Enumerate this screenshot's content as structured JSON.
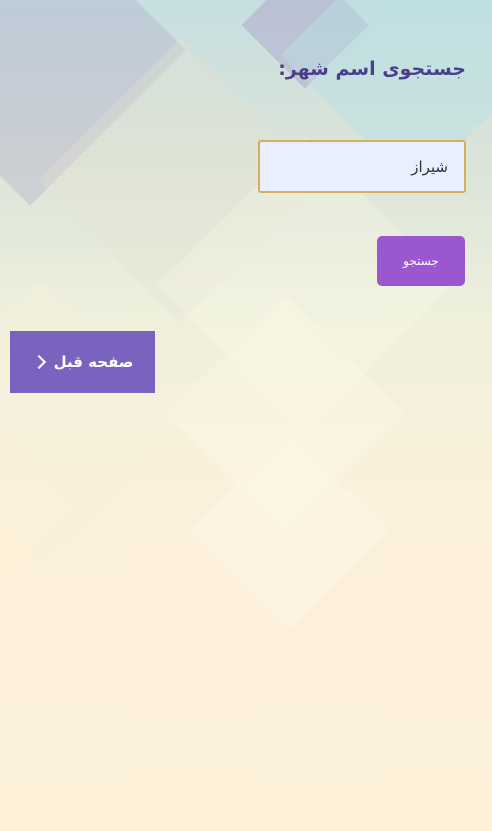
{
  "search": {
    "title": "جستجوی اسم شهر:",
    "input_value": "شیراز",
    "button_label": "جستجو"
  },
  "navigation": {
    "back_label": "صفحه قبل",
    "back_icon": "chevron-right-icon"
  },
  "colors": {
    "title": "#4b3f8c",
    "input_border": "#d8ae58",
    "input_background": "#e8efff",
    "search_button": "#9a57cf",
    "back_button": "#7a63be"
  }
}
